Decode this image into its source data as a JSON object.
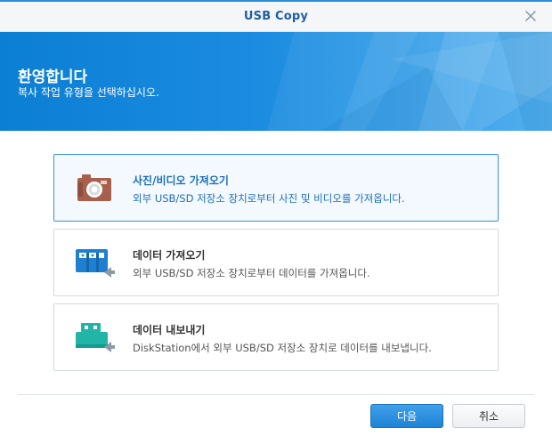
{
  "window": {
    "title": "USB Copy",
    "close_icon": "close-icon"
  },
  "banner": {
    "title": "환영합니다",
    "subtitle": "복사 작업 유형을 선택하십시오."
  },
  "options": [
    {
      "title": "사진/비디오 가져오기",
      "description": "외부 USB/SD 저장소 장치로부터 사진 및 비디오를 가져옵니다.",
      "icon": "camera-icon",
      "selected": true
    },
    {
      "title": "데이터 가져오기",
      "description": "외부 USB/SD 저장소 장치로부터 데이터를 가져옵니다.",
      "icon": "import-data-icon",
      "selected": false
    },
    {
      "title": "데이터 내보내기",
      "description": "DiskStation에서 외부 USB/SD 저장소 장치로 데이터를 내보냅니다.",
      "icon": "export-data-icon",
      "selected": false
    }
  ],
  "footer": {
    "next_label": "다음",
    "cancel_label": "취소"
  },
  "colors": {
    "accent": "#1f83d6",
    "banner": "#0b7fd4",
    "camera": "#a8604c",
    "import": "#1f7fd0",
    "export": "#20b5a6"
  }
}
